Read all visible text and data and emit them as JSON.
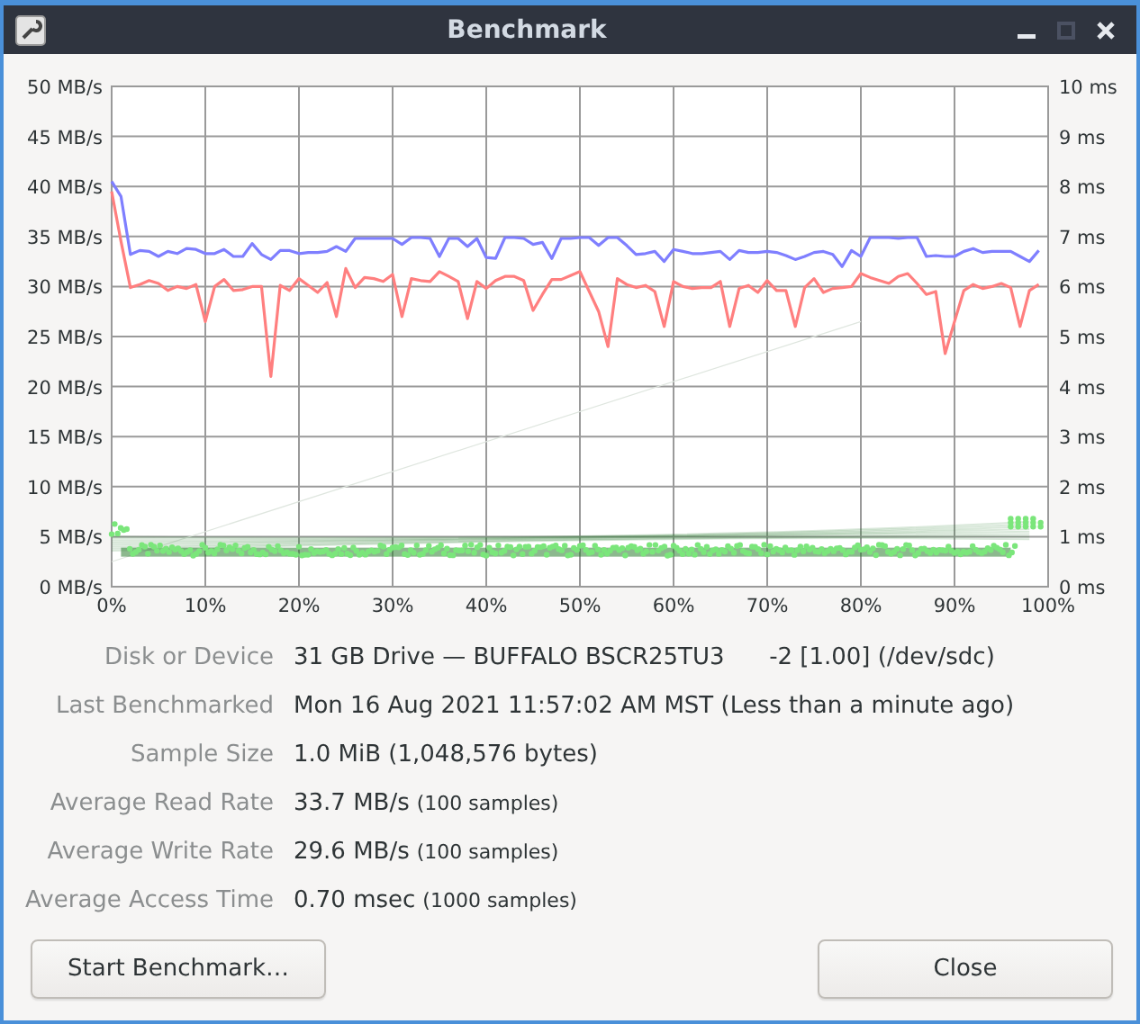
{
  "window": {
    "title": "Benchmark",
    "controls": [
      {
        "kind": "minimize",
        "disabled": false
      },
      {
        "kind": "maximize",
        "disabled": true
      },
      {
        "kind": "close",
        "disabled": false
      }
    ]
  },
  "chart": {
    "right_axis_labels": [
      "10 ms",
      "9 ms",
      "8 ms",
      "7 ms",
      "6 ms",
      "5 ms",
      "4 ms",
      "3 ms",
      "2 ms",
      "1 ms",
      "0 ms"
    ],
    "chart_data": {
      "type": "line",
      "grid": true,
      "xlim": [
        0,
        100
      ],
      "ylim": [
        0,
        50
      ],
      "xticks": [
        {
          "value": 0,
          "label": "0%"
        },
        {
          "value": 10,
          "label": "10%"
        },
        {
          "value": 20,
          "label": "20%"
        },
        {
          "value": 30,
          "label": "30%"
        },
        {
          "value": 40,
          "label": "40%"
        },
        {
          "value": 50,
          "label": "50%"
        },
        {
          "value": 60,
          "label": "60%"
        },
        {
          "value": 70,
          "label": "70%"
        },
        {
          "value": 80,
          "label": "80%"
        },
        {
          "value": 90,
          "label": "90%"
        },
        {
          "value": 100,
          "label": "100%"
        }
      ],
      "yticks": [
        {
          "value": 0,
          "label": "0 MB/s"
        },
        {
          "value": 5,
          "label": "5 MB/s"
        },
        {
          "value": 10,
          "label": "10 MB/s"
        },
        {
          "value": 15,
          "label": "15 MB/s"
        },
        {
          "value": 20,
          "label": "20 MB/s"
        },
        {
          "value": 25,
          "label": "25 MB/s"
        },
        {
          "value": 30,
          "label": "30 MB/s"
        },
        {
          "value": 35,
          "label": "35 MB/s"
        },
        {
          "value": 40,
          "label": "40 MB/s"
        },
        {
          "value": 45,
          "label": "45 MB/s"
        },
        {
          "value": 50,
          "label": "50 MB/s"
        }
      ],
      "x": [
        0,
        1,
        2,
        3,
        4,
        5,
        6,
        7,
        8,
        9,
        10,
        11,
        12,
        13,
        14,
        15,
        16,
        17,
        18,
        19,
        20,
        21,
        22,
        23,
        24,
        25,
        26,
        27,
        28,
        29,
        30,
        31,
        32,
        33,
        34,
        35,
        36,
        37,
        38,
        39,
        40,
        41,
        42,
        43,
        44,
        45,
        46,
        47,
        48,
        49,
        50,
        51,
        52,
        53,
        54,
        55,
        56,
        57,
        58,
        59,
        60,
        61,
        62,
        63,
        64,
        65,
        66,
        67,
        68,
        69,
        70,
        71,
        72,
        73,
        74,
        75,
        76,
        77,
        78,
        79,
        80,
        81,
        82,
        83,
        84,
        85,
        86,
        87,
        88,
        89,
        90,
        91,
        92,
        93,
        94,
        95,
        96,
        97,
        98,
        99
      ],
      "series": [
        {
          "color": "#7f7fff",
          "values": [
            40.5,
            39,
            33.2,
            33.6,
            33.5,
            33,
            33.5,
            33.3,
            33.8,
            33.7,
            33.3,
            33.3,
            33.7,
            33,
            33,
            34.3,
            33.2,
            32.7,
            33.6,
            33.6,
            33.3,
            33.4,
            33.4,
            33.5,
            34,
            33.5,
            34.8,
            34.8,
            34.8,
            34.8,
            34.8,
            34.2,
            34.9,
            34.9,
            34.8,
            33,
            34.8,
            34.8,
            34,
            34.8,
            32.9,
            32.8,
            34.9,
            34.9,
            34.8,
            34.2,
            34.4,
            32.8,
            34.8,
            34.8,
            34.9,
            34.9,
            34.1,
            34.9,
            34.9,
            34.1,
            33.2,
            33.3,
            33.5,
            32.5,
            33.7,
            33.5,
            33.3,
            33.3,
            33.4,
            33.5,
            32.7,
            33.6,
            33.4,
            33.4,
            33.5,
            33.4,
            33.1,
            32.7,
            33,
            33.4,
            33.5,
            33.2,
            32,
            33.6,
            33,
            34.9,
            34.9,
            34.9,
            34.8,
            34.9,
            34.9,
            33,
            33.1,
            33,
            33,
            33.5,
            33.8,
            33.4,
            33.5,
            33.5,
            33.5,
            33,
            32.5,
            33.6
          ]
        },
        {
          "color": "#ff7f7f",
          "values": [
            39.5,
            34.5,
            29.9,
            30.2,
            30.6,
            30.3,
            29.6,
            30,
            29.8,
            30.2,
            26.5,
            30,
            30.7,
            29.6,
            29.7,
            30,
            30,
            21,
            30.1,
            29.6,
            30.8,
            30.1,
            29.4,
            30.4,
            27,
            31.8,
            29.9,
            30.9,
            30.8,
            30.5,
            31.2,
            27,
            30.8,
            30.6,
            30.5,
            31.5,
            31,
            30.5,
            26.8,
            30.5,
            29.8,
            30.6,
            31,
            31,
            30.6,
            27.6,
            29.2,
            30.7,
            30.7,
            31.1,
            31.5,
            29.5,
            27.5,
            24,
            30.8,
            30.2,
            29.9,
            30.1,
            29.5,
            26,
            30.5,
            30,
            29.8,
            29.9,
            29.9,
            30.5,
            26,
            29.8,
            30.1,
            29.4,
            30.6,
            29.6,
            29.6,
            26,
            29.9,
            30.8,
            29.4,
            29.8,
            29.9,
            30,
            31.3,
            30.9,
            30.6,
            30.3,
            31,
            31.3,
            30.3,
            29.2,
            29.5,
            23.3,
            26.5,
            29.6,
            30.2,
            29.8,
            30,
            30.3,
            29.9,
            26,
            29.6,
            30.2
          ]
        }
      ]
    }
  },
  "details": [
    {
      "label": "Disk or Device",
      "value": "31 GB Drive — BUFFALO BSCR25TU3      -2 [1.00] (/dev/sdc)"
    },
    {
      "label": "Last Benchmarked",
      "value": "Mon 16 Aug 2021 11:57:02 AM MST (Less than a minute ago)"
    },
    {
      "label": "Sample Size",
      "value": "1.0 MiB (1,048,576 bytes)"
    },
    {
      "label": "Average Read Rate",
      "value": "33.7 MB/s",
      "detail": "(100 samples)"
    },
    {
      "label": "Average Write Rate",
      "value": "29.6 MB/s",
      "detail": "(100 samples)"
    },
    {
      "label": "Average Access Time",
      "value": "0.70 msec",
      "detail": "(1000 samples)"
    }
  ],
  "buttons": [
    {
      "label": "Start Benchmark…"
    },
    {
      "label": "Close"
    }
  ]
}
